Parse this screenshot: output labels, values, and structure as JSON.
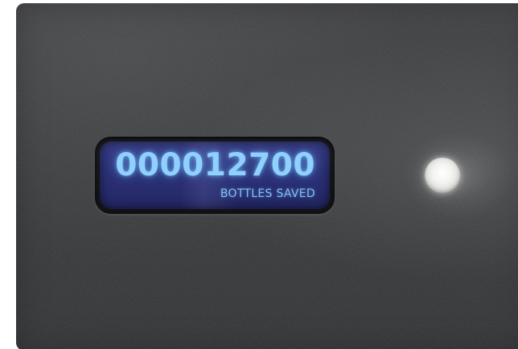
{
  "counter": {
    "value": "000012700",
    "label": "BOTTLES SAVED"
  },
  "colors": {
    "panel": "#333436",
    "screen": "#2b3075",
    "digits": "#8fd0ff",
    "led": "#f4f4f2"
  },
  "icons": {
    "indicator": "status-light-icon"
  }
}
